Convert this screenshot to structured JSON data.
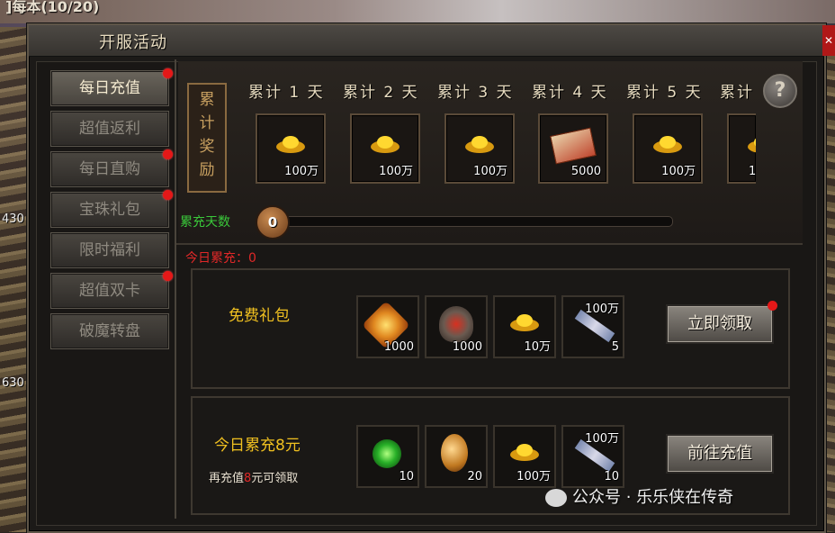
{
  "window": {
    "title": "开服活动"
  },
  "background": {
    "top_text": "]每本(10/20)",
    "side_numbers": [
      "430",
      "630"
    ]
  },
  "tabs": [
    {
      "label": "每日充值",
      "active": true,
      "dot": true
    },
    {
      "label": "超值返利",
      "active": false,
      "dot": false
    },
    {
      "label": "每日直购",
      "active": false,
      "dot": true
    },
    {
      "label": "宝珠礼包",
      "active": false,
      "dot": true
    },
    {
      "label": "限时福利",
      "active": false,
      "dot": false
    },
    {
      "label": "超值双卡",
      "active": false,
      "dot": true
    },
    {
      "label": "破魔转盘",
      "active": false,
      "dot": false
    }
  ],
  "cumulative": {
    "ribbon": "累计奖励",
    "days": [
      {
        "label": "累计 1 天",
        "item": "gold-ingot",
        "qty": "100万"
      },
      {
        "label": "累计 2 天",
        "item": "gold-ingot",
        "qty": "100万"
      },
      {
        "label": "累计 3 天",
        "item": "gold-ingot",
        "qty": "100万"
      },
      {
        "label": "累计 4 天",
        "item": "ticket",
        "qty": "5000"
      },
      {
        "label": "累计 5 天",
        "item": "gold-ingot",
        "qty": "100万"
      },
      {
        "label": "累计",
        "item": "gold-ingot",
        "qty": "1"
      }
    ],
    "help": "?",
    "progress_label": "累充天数",
    "progress_value": "0",
    "progress_fraction": 0,
    "today_text": "今日累充：0"
  },
  "cards": [
    {
      "title": "免费礼包",
      "sub": "",
      "items": [
        {
          "icon": "orange-gem",
          "qty": "1000"
        },
        {
          "icon": "shield",
          "qty": "1000"
        },
        {
          "icon": "gold-ingot",
          "qty": "10万"
        },
        {
          "icon": "scroll",
          "top": "100万",
          "qty": "5"
        }
      ],
      "button": "立即领取",
      "button_dot": true
    },
    {
      "title": "今日累充8元",
      "sub_pre": "再充值",
      "sub_red": "8",
      "sub_post": "元可领取",
      "items": [
        {
          "icon": "green-orb",
          "qty": "10"
        },
        {
          "icon": "moon-gem",
          "qty": "20"
        },
        {
          "icon": "gold-ingot",
          "qty": "100万"
        },
        {
          "icon": "scroll",
          "top": "100万",
          "qty": "10"
        }
      ],
      "button": "前往充值",
      "button_dot": false
    }
  ],
  "watermark": "公众号 · 乐乐侠在传奇",
  "colors": {
    "accent_gold": "#f0c020",
    "red_dot": "#e41818",
    "green_label": "#3ac83a"
  }
}
